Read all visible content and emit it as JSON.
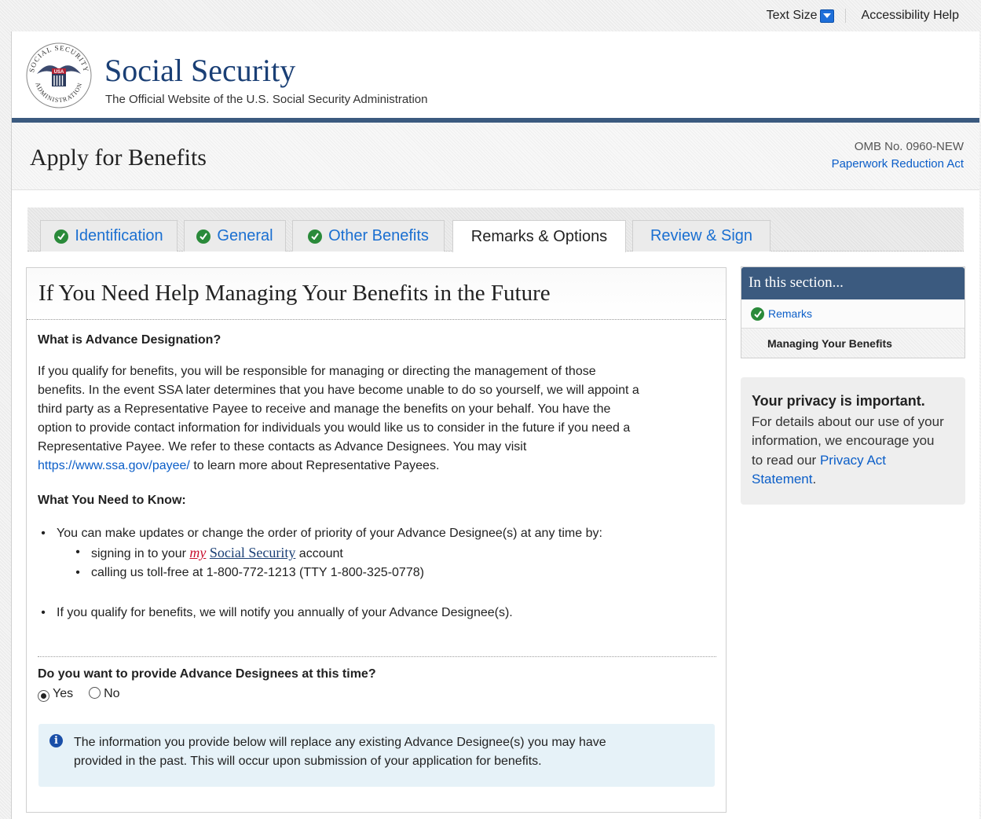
{
  "utility": {
    "text_size": "Text Size",
    "accessibility": "Accessibility Help"
  },
  "brand": {
    "title": "Social Security",
    "subtitle": "The Official Website of the U.S. Social Security Administration",
    "seal_top": "SOCIAL SECURITY",
    "seal_bottom": "ADMINISTRATION",
    "seal_center": "USA"
  },
  "page_header": {
    "title": "Apply for Benefits",
    "omb": "OMB No. 0960-NEW",
    "paperwork_link": "Paperwork Reduction Act"
  },
  "tabs": [
    {
      "label": "Identification",
      "completed": true
    },
    {
      "label": "General",
      "completed": true
    },
    {
      "label": "Other Benefits",
      "completed": true
    },
    {
      "label": "Remarks & Options",
      "active": true
    },
    {
      "label": "Review & Sign"
    }
  ],
  "main": {
    "title": "If You Need Help Managing Your Benefits in the Future",
    "q1_heading": "What is Advance Designation?",
    "para1_lines": [
      "If you qualify for benefits, you will be responsible for managing or directing the management of those",
      "benefits. In the event SSA later determines that you have become unable to do so yourself, we will appoint a",
      "third party as a Representative Payee to receive and manage the benefits on your behalf. You have the",
      "option to provide contact information for individuals you would like us to consider in the future if you need a",
      "Representative Payee. We refer to these contacts as Advance Designees. You may visit"
    ],
    "payee_link": "https://www.ssa.gov/payee/",
    "payee_after": " to learn more about Representative Payees.",
    "q2_heading": "What You Need to Know:",
    "bullet1": "You can make updates or change the order of priority of your Advance Designee(s) at any time by:",
    "sub1_before": "signing in to your ",
    "sub1_my": "my",
    "sub1_brand": "Social Security",
    "sub1_after": " account",
    "sub2": "calling us toll-free at 1-800-772-1213 (TTY 1-800-325-0778)",
    "bullet2": "If you qualify for benefits, we will notify you annually of your Advance Designee(s).",
    "question": "Do you want to provide Advance Designees at this time?",
    "option_yes": "Yes",
    "option_no": "No",
    "selected": "Yes",
    "info_line1": "The information you provide below will replace any existing Advance Designee(s) you may have",
    "info_line2": "provided in the past. This will occur upon submission of your application for benefits."
  },
  "sidebar": {
    "heading": "In this section...",
    "items": [
      {
        "label": "Remarks",
        "completed": true
      },
      {
        "label": "Managing Your Benefits",
        "current": true
      }
    ]
  },
  "privacy": {
    "title": "Your privacy is important.",
    "lines": [
      "For details about our use of your",
      "information, we encourage you",
      "to read our "
    ],
    "link_a": "Privacy Act",
    "link_b": "Statement",
    "end": "."
  },
  "colors": {
    "header_bar": "#3b5a7f",
    "link": "#0b5ec8",
    "brand": "#1a3f75",
    "check": "#2a8a3a",
    "info_bg": "#e6f2f8"
  }
}
